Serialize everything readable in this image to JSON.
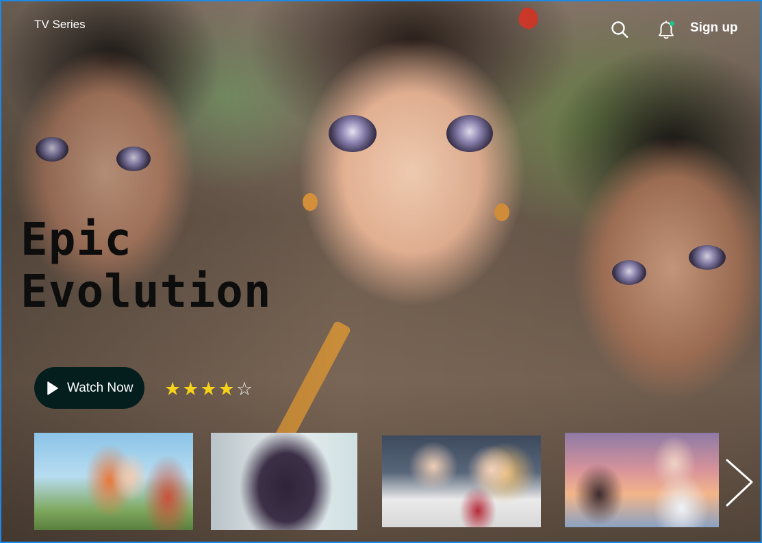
{
  "header": {
    "section_title": "TV Series",
    "signup_label": "Sign up",
    "icons": {
      "search": "search-icon",
      "notifications": "bell-icon"
    },
    "notification_dot_color": "#1ec48a"
  },
  "hero": {
    "title_line1": "Epic",
    "title_line2": "Evolution",
    "watch_label": "Watch Now",
    "rating": 4,
    "rating_max": 5,
    "star_color": "#f6d21a"
  },
  "carousel": {
    "items": [
      {
        "art": "two-students-outdoors"
      },
      {
        "art": "girl-profile-window"
      },
      {
        "art": "boy-and-blonde-girl-uniform"
      },
      {
        "art": "couple-sunset"
      }
    ],
    "next_icon": "chevron-right-icon"
  }
}
